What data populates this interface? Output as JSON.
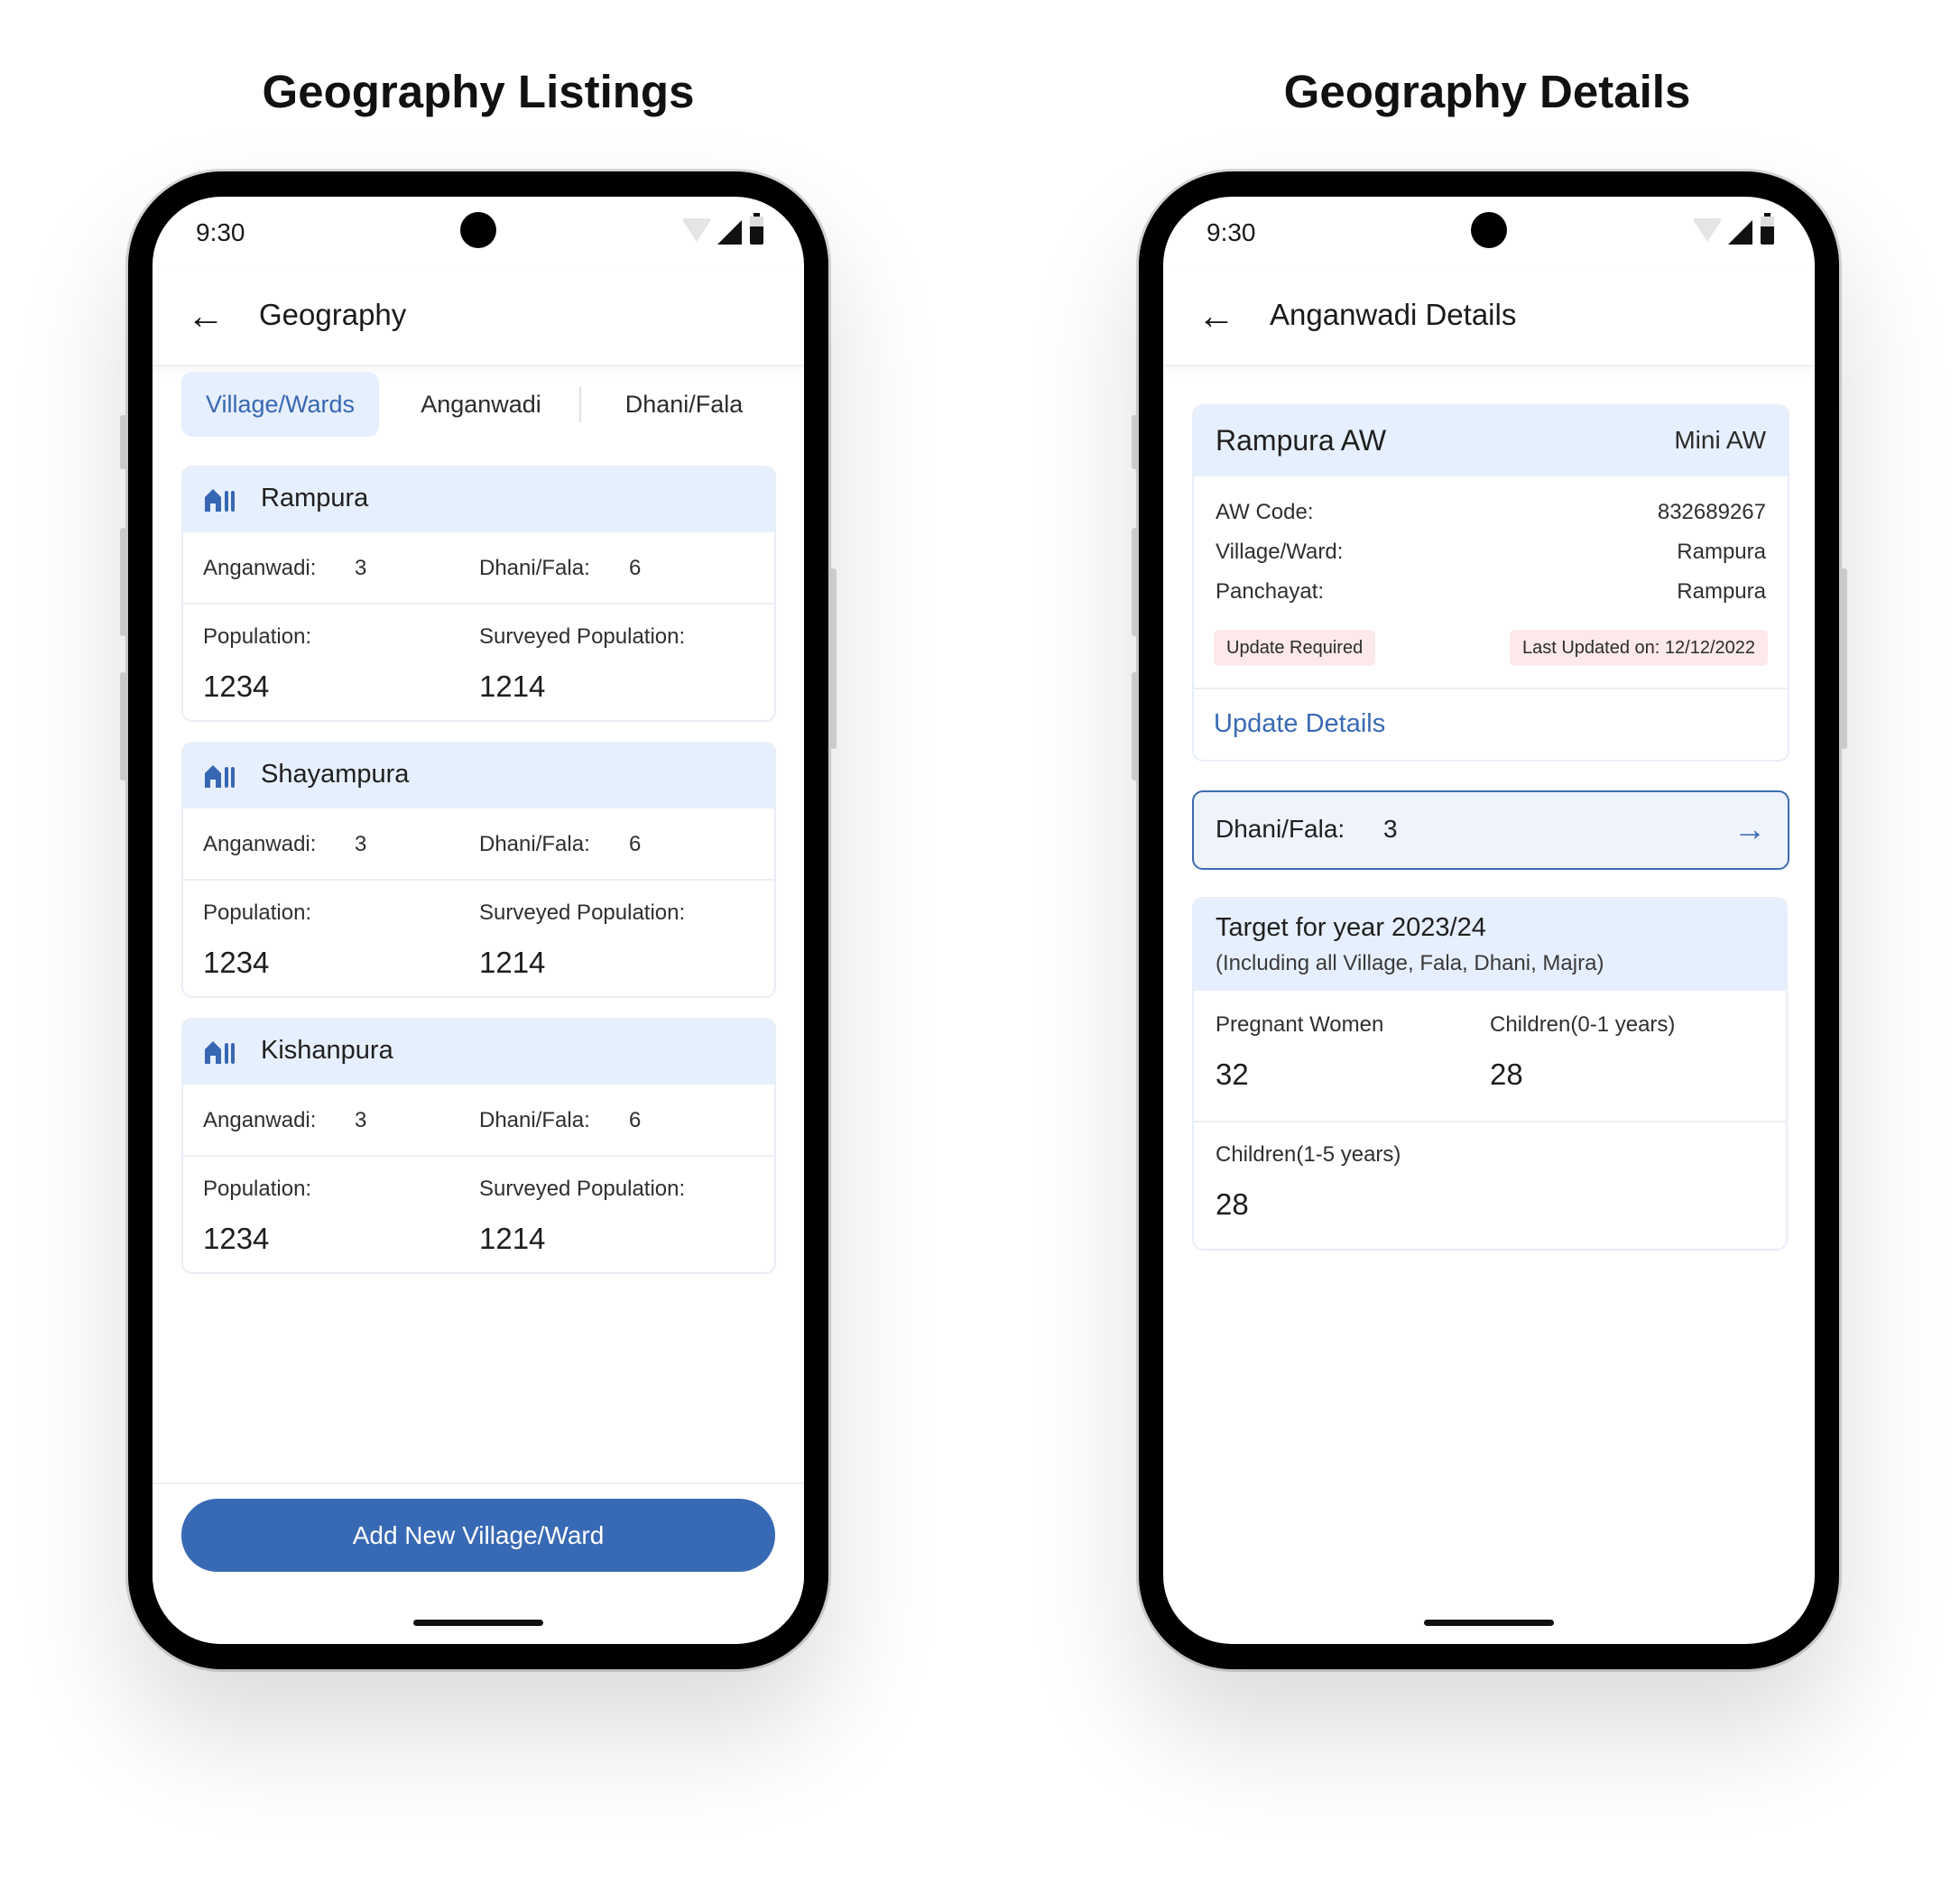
{
  "titles": {
    "left": "Geography Listings",
    "right": "Geography Details"
  },
  "status": {
    "time": "9:30"
  },
  "listing": {
    "title": "Geography",
    "tabs": [
      "Village/Wards",
      "Anganwadi",
      "Dhani/Fala"
    ],
    "active_tab": "Village/Wards",
    "labels": {
      "anganwadi": "Anganwadi:",
      "dhani": "Dhani/Fala:",
      "population": "Population:",
      "surveyed": "Surveyed Population:"
    },
    "villages": [
      {
        "name": "Rampura",
        "anganwadi": "3",
        "dhani": "6",
        "population": "1234",
        "surveyed": "1214"
      },
      {
        "name": "Shayampura",
        "anganwadi": "3",
        "dhani": "6",
        "population": "1234",
        "surveyed": "1214"
      },
      {
        "name": "Kishanpura",
        "anganwadi": "3",
        "dhani": "6",
        "population": "1234",
        "surveyed": "1214"
      }
    ],
    "add_button": "Add New Village/Ward"
  },
  "details": {
    "title": "Anganwadi Details",
    "aw_name": "Rampura AW",
    "aw_type": "Mini AW",
    "fields": [
      {
        "label": "AW Code:",
        "value": "832689267"
      },
      {
        "label": "Village/Ward:",
        "value": "Rampura"
      },
      {
        "label": "Panchayat:",
        "value": "Rampura"
      }
    ],
    "badge_update": "Update Required",
    "badge_last": "Last Updated on: 12/12/2022",
    "update_link": "Update Details",
    "dhani_label": "Dhani/Fala:",
    "dhani_value": "3",
    "target_title": "Target for year 2023/24",
    "target_subtitle": "(Including all Village, Fala, Dhani, Majra)",
    "targets": [
      {
        "label": "Pregnant Women",
        "value": "32"
      },
      {
        "label": "Children(0-1 years)",
        "value": "28"
      },
      {
        "label": "Children(1-5 years)",
        "value": "28"
      }
    ]
  },
  "colors": {
    "accent": "#3869b4",
    "header_bg": "#e6effd",
    "badge_bg": "#fde9e9"
  }
}
